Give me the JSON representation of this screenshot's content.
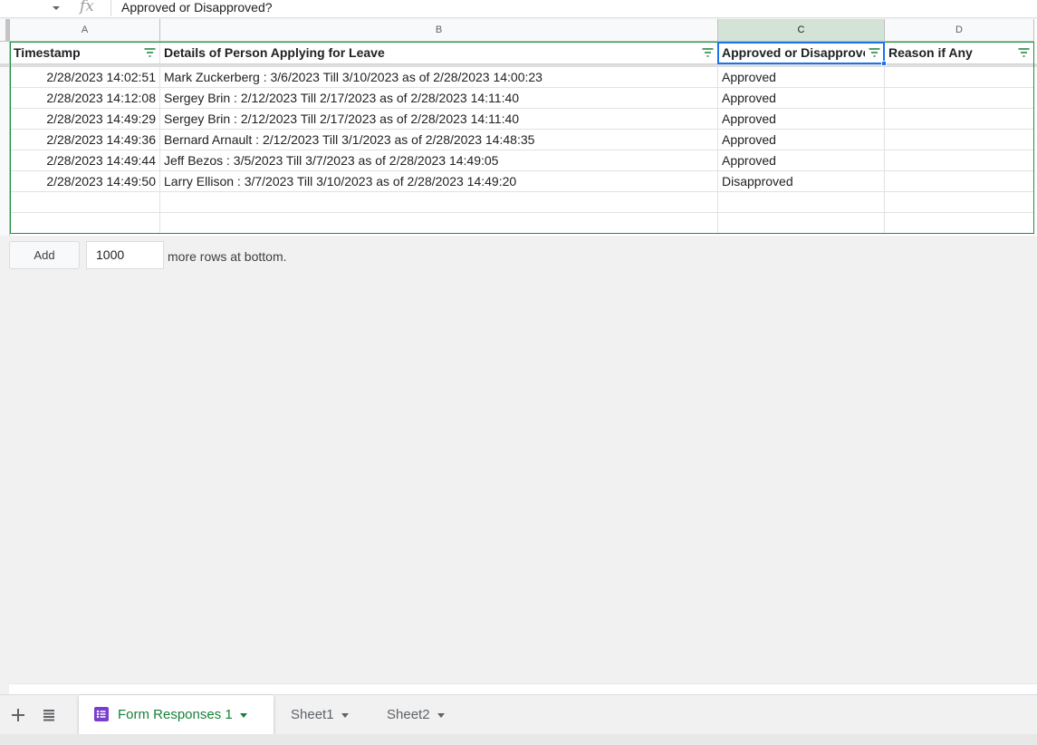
{
  "formula_bar": {
    "fx_label": "fx",
    "content": "Approved or Disapproved?"
  },
  "columns": [
    "A",
    "B",
    "C",
    "D"
  ],
  "selected_column": "C",
  "headers": [
    "Timestamp",
    "Details of Person Applying for Leave",
    "Approved or Disapproved?",
    "Reason if Any"
  ],
  "rows": [
    [
      "2/28/2023 14:02:51",
      "Mark Zuckerberg : 3/6/2023 Till 3/10/2023 as of 2/28/2023 14:00:23",
      "Approved",
      ""
    ],
    [
      "2/28/2023 14:12:08",
      "Sergey Brin : 2/12/2023 Till 2/17/2023 as of 2/28/2023 14:11:40",
      "Approved",
      ""
    ],
    [
      "2/28/2023 14:49:29",
      "Sergey Brin : 2/12/2023 Till 2/17/2023 as of 2/28/2023 14:11:40",
      "Approved",
      ""
    ],
    [
      "2/28/2023 14:49:36",
      "Bernard Arnault : 2/12/2023 Till 3/1/2023 as of 2/28/2023 14:48:35",
      "Approved",
      ""
    ],
    [
      "2/28/2023 14:49:44",
      "Jeff Bezos : 3/5/2023 Till 3/7/2023 as of 2/28/2023 14:49:05",
      "Approved",
      ""
    ],
    [
      "2/28/2023 14:49:50",
      "Larry Ellison : 3/7/2023 Till 3/10/2023 as of 2/28/2023 14:49:20",
      "Disapproved",
      ""
    ],
    [
      "",
      "",
      "",
      ""
    ],
    [
      "",
      "",
      "",
      ""
    ]
  ],
  "add_rows": {
    "button_label": "Add",
    "count": "1000",
    "suffix": "more rows at bottom."
  },
  "sheet_tabs": [
    {
      "label": "Form Responses 1",
      "active": true
    },
    {
      "label": "Sheet1",
      "active": false
    },
    {
      "label": "Sheet2",
      "active": false
    }
  ],
  "colors": {
    "accent_green": "#188038",
    "selection_blue": "#1a73e8",
    "banding_border": "#1e8e3e",
    "forms_purple": "#7b3fcf"
  }
}
